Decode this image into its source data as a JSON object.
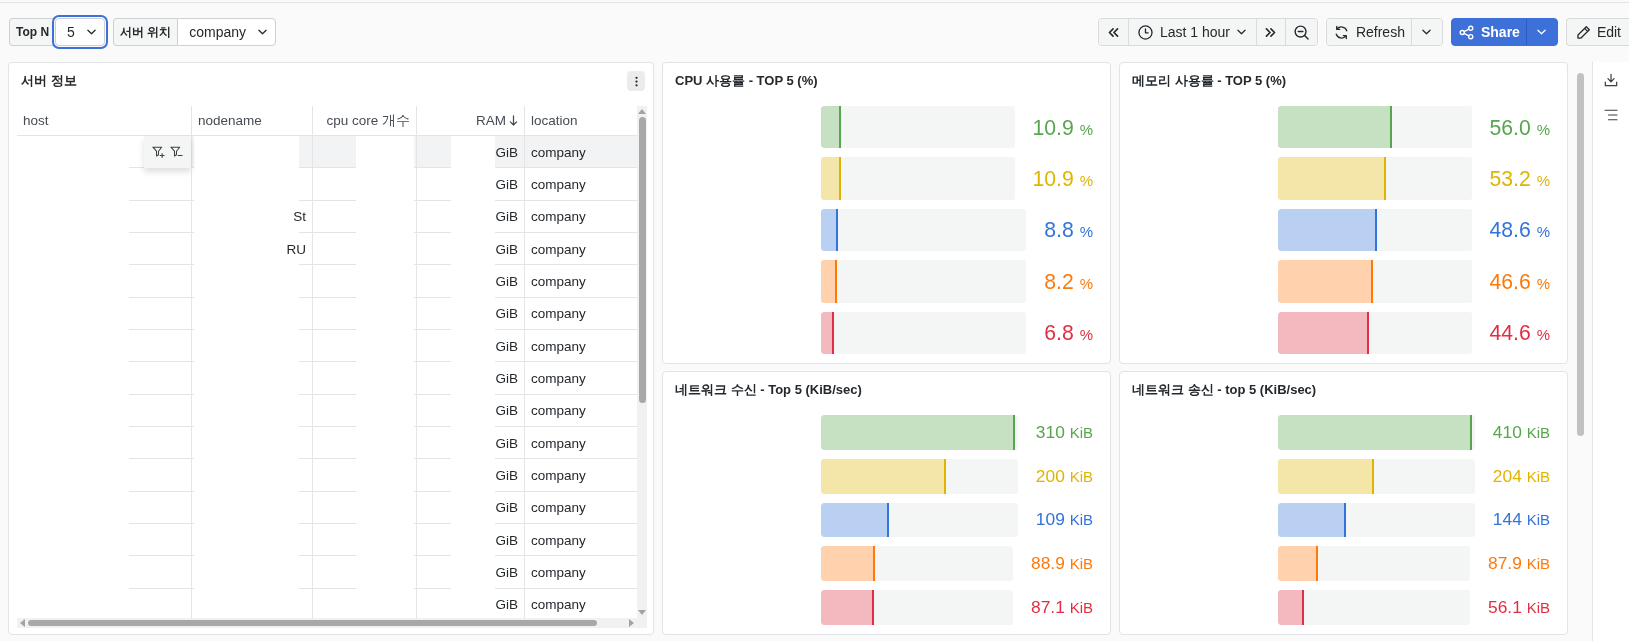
{
  "variables": [
    {
      "label": "Top N",
      "value": "5",
      "focused": true
    },
    {
      "label": "서버 위치",
      "value": "company",
      "focused": false
    }
  ],
  "time_picker": {
    "range": "Last 1 hour"
  },
  "actions": {
    "refresh": "Refresh",
    "share": "Share",
    "edit": "Edit"
  },
  "table_panel": {
    "title": "서버 정보",
    "columns": [
      {
        "label": "host",
        "sorted": false
      },
      {
        "label": "nodename",
        "sorted": false
      },
      {
        "label": "cpu core 개수",
        "sorted": false
      },
      {
        "label": "RAM",
        "sorted": true
      },
      {
        "label": "location",
        "sorted": false
      }
    ],
    "rows": [
      {
        "hovered": true,
        "ram": "GiB",
        "location": "company"
      },
      {
        "hovered": false,
        "ram": "GiB",
        "location": "company"
      },
      {
        "hovered": false,
        "nodename": "St",
        "ram": "GiB",
        "location": "company"
      },
      {
        "hovered": false,
        "nodename": "RU",
        "ram": "GiB",
        "location": "company"
      },
      {
        "hovered": false,
        "ram": "GiB",
        "location": "company"
      },
      {
        "hovered": false,
        "ram": "GiB",
        "location": "company"
      },
      {
        "hovered": false,
        "ram": "GiB",
        "location": "company"
      },
      {
        "hovered": false,
        "ram": "GiB",
        "location": "company"
      },
      {
        "hovered": false,
        "ram": "GiB",
        "location": "company"
      },
      {
        "hovered": false,
        "ram": "GiB",
        "location": "company"
      },
      {
        "hovered": false,
        "ram": "GiB",
        "location": "company"
      },
      {
        "hovered": false,
        "ram": "GiB",
        "location": "company"
      },
      {
        "hovered": false,
        "ram": "GiB",
        "location": "company"
      },
      {
        "hovered": false,
        "ram": "GiB",
        "location": "company"
      },
      {
        "hovered": false,
        "ram": "GiB",
        "location": "company"
      }
    ]
  },
  "gauge_panels": [
    {
      "title": "CPU 사용률 - TOP 5 (%)",
      "bars": [
        {
          "value": "10.9",
          "unit": "%",
          "level": 0.109,
          "color": "#56a64b"
        },
        {
          "value": "10.9",
          "unit": "%",
          "level": 0.109,
          "color": "#e0b400"
        },
        {
          "value": "8.8",
          "unit": "%",
          "level": 0.088,
          "color": "#3274d9"
        },
        {
          "value": "8.2",
          "unit": "%",
          "level": 0.082,
          "color": "#ff780a"
        },
        {
          "value": "6.8",
          "unit": "%",
          "level": 0.068,
          "color": "#e02f44"
        }
      ]
    },
    {
      "title": "메모리 사용률 - TOP 5 (%)",
      "bars": [
        {
          "value": "56.0",
          "unit": "%",
          "level": 0.6,
          "color": "#56a64b"
        },
        {
          "value": "53.2",
          "unit": "%",
          "level": 0.57,
          "color": "#e0b400"
        },
        {
          "value": "48.6",
          "unit": "%",
          "level": 0.52,
          "color": "#3274d9"
        },
        {
          "value": "46.6",
          "unit": "%",
          "level": 0.5,
          "color": "#ff780a"
        },
        {
          "value": "44.6",
          "unit": "%",
          "level": 0.48,
          "color": "#e02f44"
        }
      ]
    },
    {
      "title": "네트워크 수신 - Top 5 (KiB/sec)",
      "bars": [
        {
          "value": "310",
          "unit": "KiB",
          "level": 1,
          "color": "#56a64b"
        },
        {
          "value": "200",
          "unit": "KiB",
          "level": 0.645,
          "color": "#e0b400"
        },
        {
          "value": "109",
          "unit": "KiB",
          "level": 0.352,
          "color": "#3274d9"
        },
        {
          "value": "88.9",
          "unit": "KiB",
          "level": 0.287,
          "color": "#ff780a"
        },
        {
          "value": "87.1",
          "unit": "KiB",
          "level": 0.281,
          "color": "#e02f44"
        }
      ]
    },
    {
      "title": "네트워크 송신 - top 5 (KiB/sec)",
      "bars": [
        {
          "value": "410",
          "unit": "KiB",
          "level": 1,
          "color": "#56a64b"
        },
        {
          "value": "204",
          "unit": "KiB",
          "level": 0.498,
          "color": "#e0b400"
        },
        {
          "value": "144",
          "unit": "KiB",
          "level": 0.351,
          "color": "#3274d9"
        },
        {
          "value": "87.9",
          "unit": "KiB",
          "level": 0.214,
          "color": "#ff780a"
        },
        {
          "value": "56.1",
          "unit": "KiB",
          "level": 0.137,
          "color": "#e02f44"
        }
      ]
    }
  ]
}
